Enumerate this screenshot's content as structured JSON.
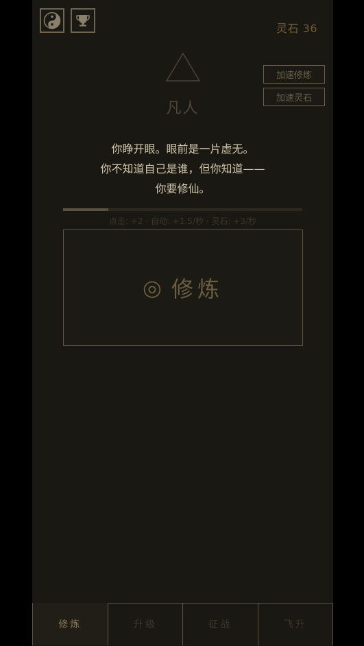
{
  "header": {
    "spirit_stones_label": "灵石 36",
    "icons": [
      "yin-yang-icon",
      "trophy-icon"
    ]
  },
  "side_buttons": {
    "speed_cultivate": "加速修炼",
    "speed_stones": "加速灵石"
  },
  "realm": {
    "title": "凡人"
  },
  "intro": {
    "line1": "你睁开眼。眼前是一片虚无。",
    "line2": "你不知道自己是谁，但你知道——",
    "line3": "你要修仙。"
  },
  "progress": {
    "value": 0.19
  },
  "rates": "点击: +2 · 自动: +1.5/秒 · 灵石: +3/秒",
  "cultivate_button": {
    "glyph": "◎",
    "label": "修炼"
  },
  "tabs": [
    {
      "label": "修炼",
      "active": true
    },
    {
      "label": "升级",
      "active": false
    },
    {
      "label": "征战",
      "active": false
    },
    {
      "label": "飞升",
      "active": false
    }
  ],
  "colors": {
    "background": "#1a1813",
    "accent_gold": "#8a7a58",
    "intro_text": "#d3c8ae"
  }
}
